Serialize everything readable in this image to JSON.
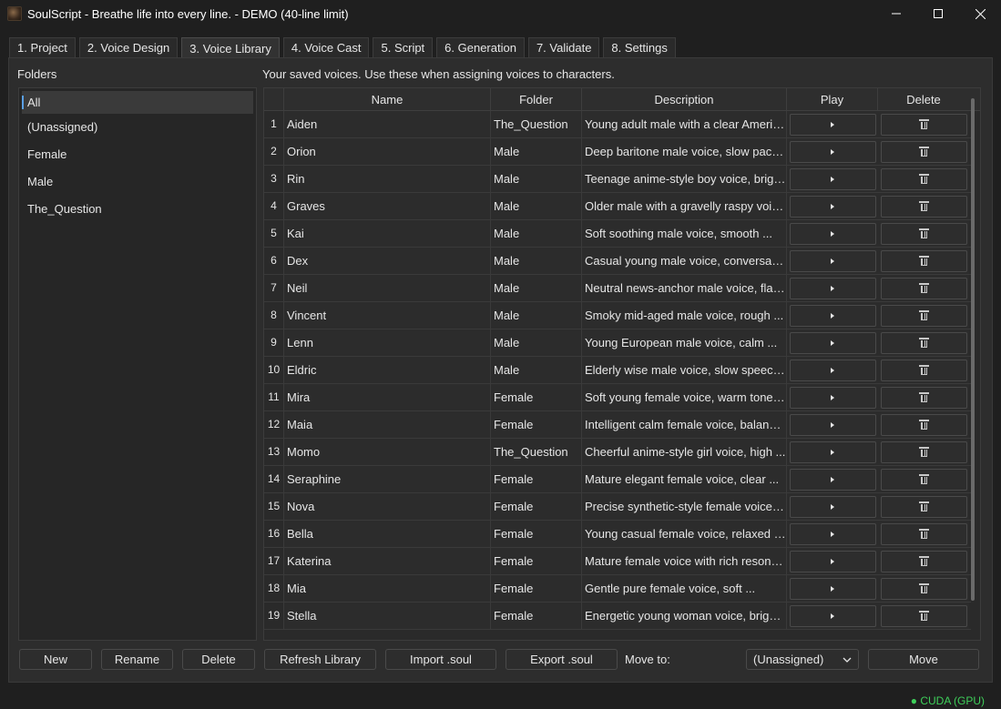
{
  "window": {
    "title": "SoulScript - Breathe life into every line. - DEMO (40-line limit)"
  },
  "tabs": [
    {
      "label": "1. Project"
    },
    {
      "label": "2. Voice Design"
    },
    {
      "label": "3. Voice Library"
    },
    {
      "label": "4. Voice Cast"
    },
    {
      "label": "5. Script"
    },
    {
      "label": "6. Generation"
    },
    {
      "label": "7. Validate"
    },
    {
      "label": "8. Settings"
    }
  ],
  "active_tab": "3. Voice Library",
  "folders": {
    "label": "Folders",
    "items": [
      "All",
      "(Unassigned)",
      "Female",
      "Male",
      "The_Question"
    ],
    "selected": "All"
  },
  "info_text": "Your saved voices. Use these when assigning voices to characters.",
  "table": {
    "headers": {
      "name": "Name",
      "folder": "Folder",
      "description": "Description",
      "play": "Play",
      "delete": "Delete"
    },
    "rows": [
      {
        "num": "1",
        "name": "Aiden",
        "folder": "The_Question",
        "description": "Young adult male with a clear America..."
      },
      {
        "num": "2",
        "name": "Orion",
        "folder": "Male",
        "description": "Deep baritone male voice, slow pacing, ..."
      },
      {
        "num": "3",
        "name": "Rin",
        "folder": "Male",
        "description": "Teenage anime-style boy voice, bright ..."
      },
      {
        "num": "4",
        "name": "Graves",
        "folder": "Male",
        "description": "Older male with a gravelly raspy voice, ..."
      },
      {
        "num": "5",
        "name": "Kai",
        "folder": "Male",
        "description": "Soft soothing male voice, smooth ..."
      },
      {
        "num": "6",
        "name": "Dex",
        "folder": "Male",
        "description": "Casual young male voice, conversation..."
      },
      {
        "num": "7",
        "name": "Neil",
        "folder": "Male",
        "description": "Neutral news-anchor male voice, flat ..."
      },
      {
        "num": "8",
        "name": "Vincent",
        "folder": "Male",
        "description": "Smoky mid-aged male voice, rough ..."
      },
      {
        "num": "9",
        "name": "Lenn",
        "folder": "Male",
        "description": "Young European male voice, calm ..."
      },
      {
        "num": "10",
        "name": "Eldric",
        "folder": "Male",
        "description": "Elderly wise male voice, slow speech, ..."
      },
      {
        "num": "11",
        "name": "Mira",
        "folder": "Female",
        "description": "Soft young female voice, warm tone, ..."
      },
      {
        "num": "12",
        "name": "Maia",
        "folder": "Female",
        "description": "Intelligent calm female voice, balanced ..."
      },
      {
        "num": "13",
        "name": "Momo",
        "folder": "The_Question",
        "description": "Cheerful anime-style girl voice, high ..."
      },
      {
        "num": "14",
        "name": "Seraphine",
        "folder": "Female",
        "description": "Mature elegant female voice, clear ..."
      },
      {
        "num": "15",
        "name": "Nova",
        "folder": "Female",
        "description": "Precise synthetic-style female voice, ..."
      },
      {
        "num": "16",
        "name": "Bella",
        "folder": "Female",
        "description": "Young casual female voice, relaxed ton..."
      },
      {
        "num": "17",
        "name": "Katerina",
        "folder": "Female",
        "description": "Mature female voice with rich resonanc..."
      },
      {
        "num": "18",
        "name": "Mia",
        "folder": "Female",
        "description": "Gentle pure female voice, soft ..."
      },
      {
        "num": "19",
        "name": "Stella",
        "folder": "Female",
        "description": "Energetic young woman voice, bright ..."
      }
    ]
  },
  "buttons": {
    "new": "New",
    "rename": "Rename",
    "delete": "Delete",
    "refresh": "Refresh Library",
    "import": "Import .soul",
    "export": "Export .soul",
    "move_to_label": "Move to:",
    "move_target": "(Unassigned)",
    "move": "Move"
  },
  "status": {
    "device": "● CUDA (GPU)"
  },
  "icons": {
    "play": "play-icon",
    "delete": "trash-icon",
    "minimize": "minimize-icon",
    "maximize": "maximize-icon",
    "close": "close-icon"
  },
  "colors": {
    "accent": "#5aa0e6",
    "status_ok": "#3ecf5a",
    "background": "#1f1f1f"
  }
}
